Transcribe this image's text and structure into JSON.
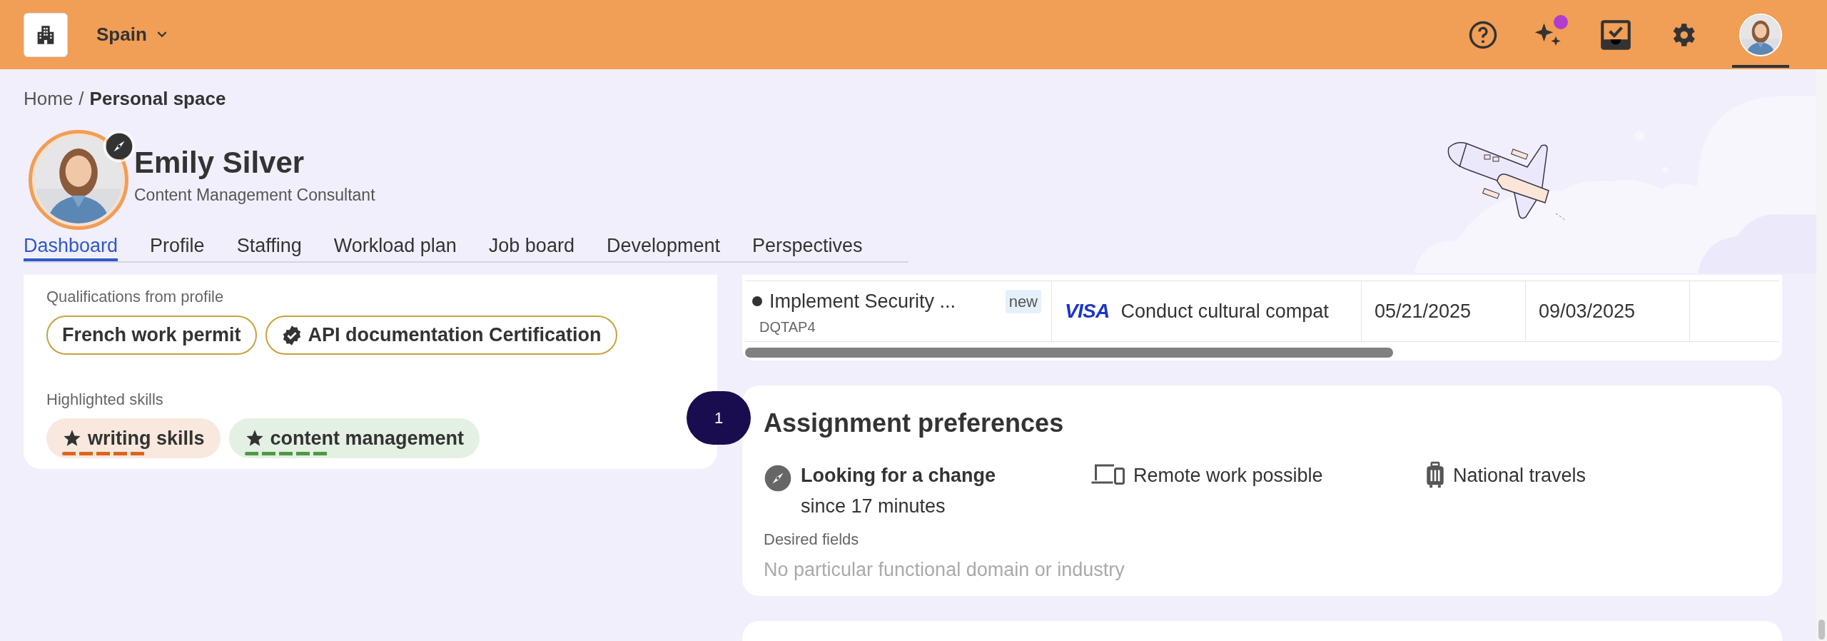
{
  "top_bar": {
    "country": "Spain",
    "assistant_notification": true
  },
  "breadcrumb": {
    "separator": "/",
    "items": [
      {
        "label": "Home",
        "current": false
      },
      {
        "label": "Personal space",
        "current": true
      }
    ]
  },
  "profile": {
    "name": "Emily Silver",
    "job_title": "Content Management Consultant"
  },
  "tabs": [
    {
      "label": "Dashboard",
      "selected": true
    },
    {
      "label": "Profile",
      "selected": false
    },
    {
      "label": "Staffing",
      "selected": false
    },
    {
      "label": "Workload plan",
      "selected": false
    },
    {
      "label": "Job board",
      "selected": false
    },
    {
      "label": "Development",
      "selected": false
    },
    {
      "label": "Perspectives",
      "selected": false
    }
  ],
  "qualifications": {
    "heading": "Qualifications from profile",
    "items": [
      {
        "label": "French work permit",
        "certified": false
      },
      {
        "label": "API documentation Certification",
        "certified": true
      }
    ]
  },
  "skills": {
    "heading": "Highlighted skills",
    "items": [
      {
        "label": "writing skills",
        "color": "#d9661f"
      },
      {
        "label": "content management",
        "color": "#4d9a45"
      }
    ]
  },
  "step_badge": "1",
  "table": {
    "rows": [
      {
        "title": "Implement Security ...",
        "badge": "new",
        "code": "DQTAP4",
        "client_logo": "VISA",
        "mission": "Conduct cultural compat",
        "start": "05/21/2025",
        "end": "09/03/2025"
      }
    ]
  },
  "preferences": {
    "title": "Assignment preferences",
    "items": [
      {
        "kind": "status",
        "label": "Looking for a change",
        "detail": "since 17 minutes"
      },
      {
        "kind": "remote",
        "label": "Remote work possible"
      },
      {
        "kind": "travel",
        "label": "National travels"
      }
    ],
    "fields_label": "Desired fields",
    "fields_value": "No particular functional domain or industry"
  }
}
